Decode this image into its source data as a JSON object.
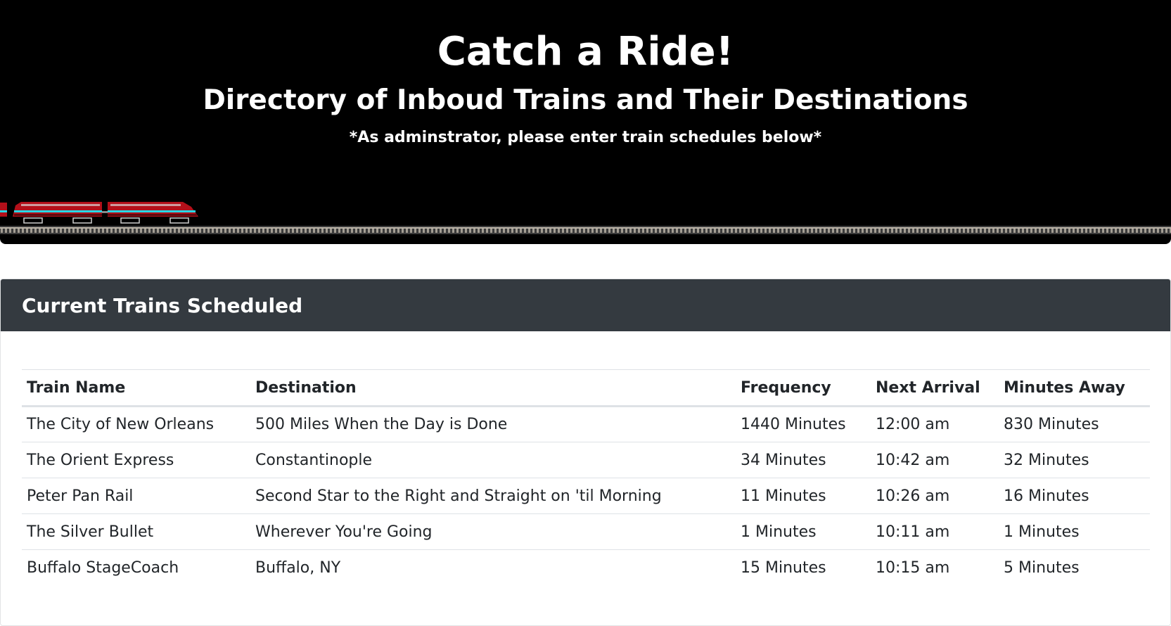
{
  "hero": {
    "title": "Catch a Ride!",
    "subtitle": "Directory of Inboud Trains and Their Destinations",
    "note": "*As adminstrator, please enter train schedules below*",
    "background_color": "#000000",
    "train_colors": {
      "body": "#b3101a",
      "stripe": "#27d8e6"
    }
  },
  "schedule_card": {
    "header_title": "Current Trains Scheduled",
    "header_color": "#343a40",
    "columns": [
      "Train Name",
      "Destination",
      "Frequency",
      "Next Arrival",
      "Minutes Away"
    ],
    "rows": [
      {
        "name": "The City of New Orleans",
        "destination": "500 Miles When the Day is Done",
        "frequency": "1440 Minutes",
        "next_arrival": "12:00 am",
        "minutes_away": "830 Minutes"
      },
      {
        "name": "The Orient Express",
        "destination": "Constantinople",
        "frequency": "34 Minutes",
        "next_arrival": "10:42 am",
        "minutes_away": "32 Minutes"
      },
      {
        "name": "Peter Pan Rail",
        "destination": "Second Star to the Right and Straight on 'til Morning",
        "frequency": "11 Minutes",
        "next_arrival": "10:26 am",
        "minutes_away": "16 Minutes"
      },
      {
        "name": "The Silver Bullet",
        "destination": "Wherever You're Going",
        "frequency": "1 Minutes",
        "next_arrival": "10:11 am",
        "minutes_away": "1 Minutes"
      },
      {
        "name": "Buffalo StageCoach",
        "destination": "Buffalo, NY",
        "frequency": "15 Minutes",
        "next_arrival": "10:15 am",
        "minutes_away": "5 Minutes"
      }
    ]
  }
}
